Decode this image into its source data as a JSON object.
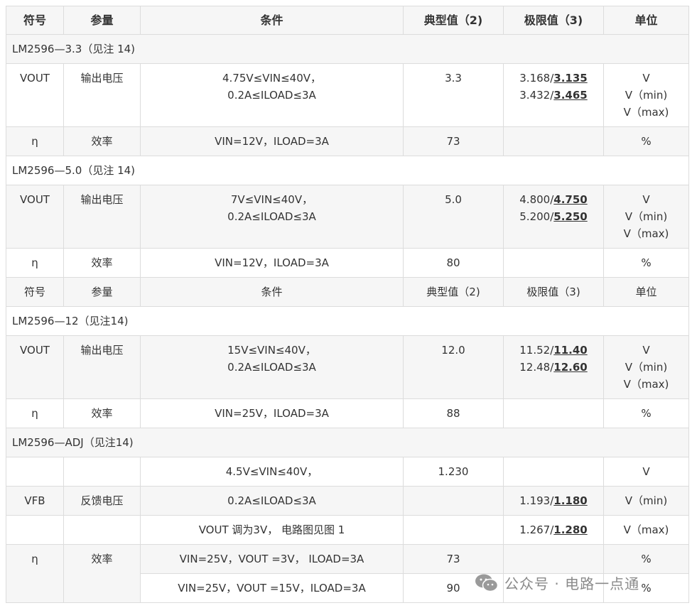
{
  "header": [
    "符号",
    "参量",
    "条件",
    "典型值（2)",
    "极限值（3)",
    "单位"
  ],
  "sections": {
    "s33": "LM2596—3.3（见注 14)",
    "s50": "LM2596—5.0（见注 14)",
    "s12": "LM2596—12（见注14)",
    "sadj": "LM2596—ADJ（见注14)"
  },
  "rows": {
    "r33_vout": {
      "sym": "VOUT",
      "param": "输出电压",
      "cond1": "4.75V≤VIN≤40V，",
      "cond2": "0.2A≤ILOAD≤3A",
      "typ": "3.3",
      "lim1a": "3.168/",
      "lim1b": "3.135",
      "lim2a": "3.432/",
      "lim2b": "3.465",
      "u1": "V",
      "u2": "V（min)",
      "u3": "V（max)"
    },
    "r33_eff": {
      "sym": "η",
      "param": "效率",
      "cond": "VIN=12V，ILOAD=3A",
      "typ": "73",
      "unit": "%"
    },
    "r50_vout": {
      "sym": "VOUT",
      "param": "输出电压",
      "cond1": "7V≤VIN≤40V，",
      "cond2": "0.2A≤ILOAD≤3A",
      "typ": "5.0",
      "lim1a": "4.800/",
      "lim1b": "4.750",
      "lim2a": "5.200/",
      "lim2b": "5.250",
      "u1": "V",
      "u2": "V（min)",
      "u3": "V（max)"
    },
    "r50_eff": {
      "sym": "η",
      "param": "效率",
      "cond": "VIN=12V，ILOAD=3A",
      "typ": "80",
      "unit": "%"
    },
    "r12_vout": {
      "sym": "VOUT",
      "param": "输出电压",
      "cond1": "15V≤VIN≤40V，",
      "cond2": "0.2A≤ILOAD≤3A",
      "typ": "12.0",
      "lim1a": "11.52/",
      "lim1b": "11.40",
      "lim2a": "12.48/",
      "lim2b": "12.60",
      "u1": "V",
      "u2": "V（min)",
      "u3": "V（max)"
    },
    "r12_eff": {
      "sym": "η",
      "param": "效率",
      "cond": "VIN=25V，ILOAD=3A",
      "typ": "88",
      "unit": "%"
    },
    "adj1": {
      "cond": "4.5V≤VIN≤40V，",
      "typ": "1.230",
      "unit": "V"
    },
    "adj2": {
      "sym": "VFB",
      "param": "反馈电压",
      "cond": "0.2A≤ILOAD≤3A",
      "lima": "1.193/",
      "limb": "1.180",
      "unit": "V（min)"
    },
    "adj3": {
      "cond": "VOUT 调为3V， 电路图见图 1",
      "lima": "1.267/",
      "limb": "1.280",
      "unit": "V（max)"
    },
    "adj4": {
      "sym": "η",
      "param": "效率",
      "cond": "VIN=25V，VOUT =3V， ILOAD=3A",
      "typ": "73",
      "unit": "%"
    },
    "adj5": {
      "cond": "VIN=25V，VOUT =15V，ILOAD=3A",
      "typ": "90",
      "unit": "%"
    }
  },
  "watermark": "公众号 · 电路一点通"
}
